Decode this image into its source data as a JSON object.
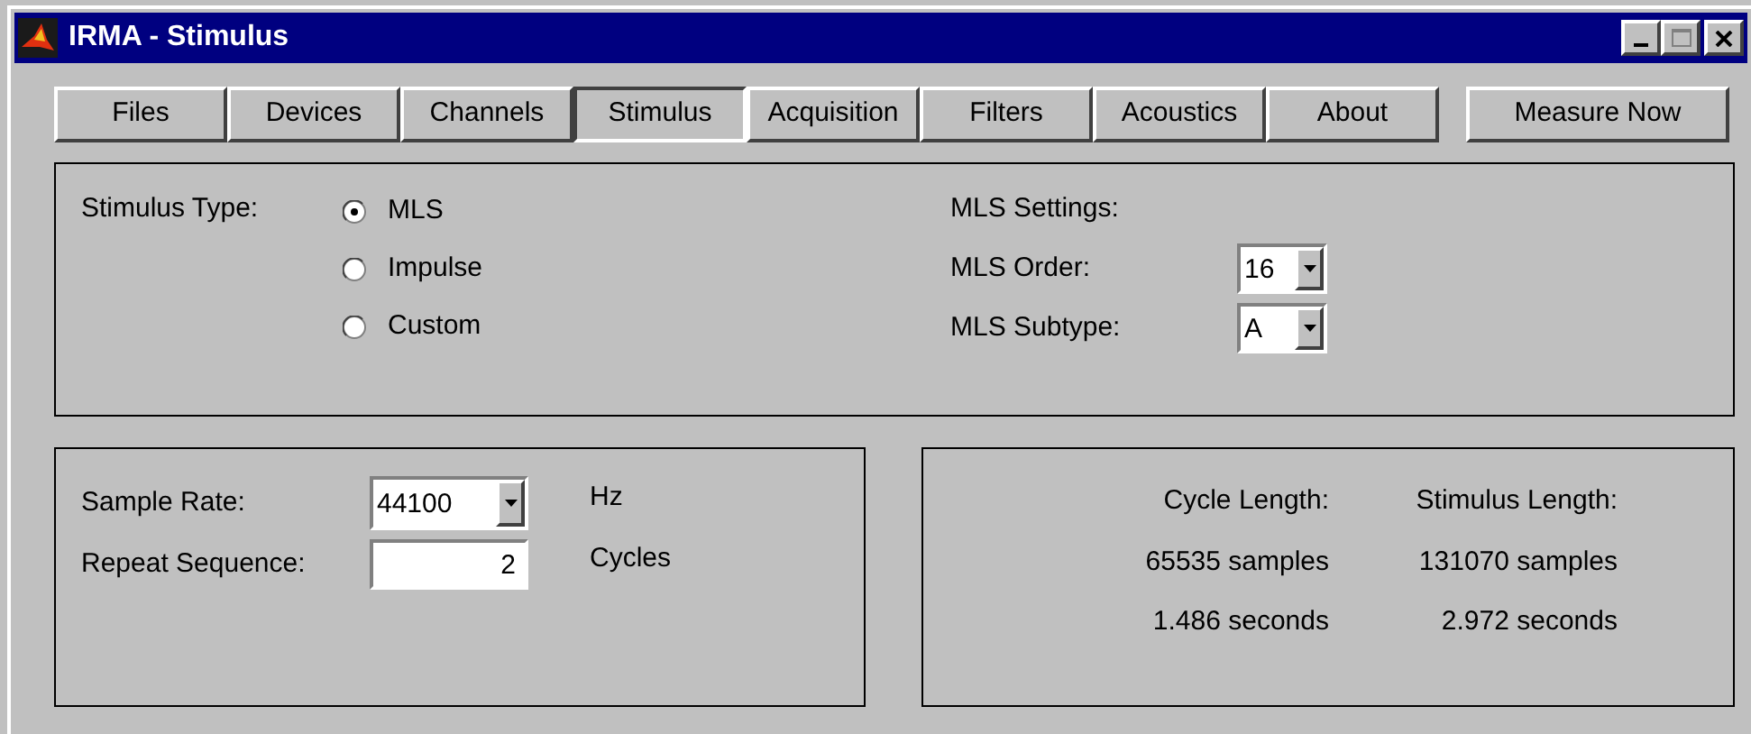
{
  "window": {
    "title": "IRMA - Stimulus"
  },
  "tabs": [
    {
      "label": "Files",
      "selected": false
    },
    {
      "label": "Devices",
      "selected": false
    },
    {
      "label": "Channels",
      "selected": false
    },
    {
      "label": "Stimulus",
      "selected": true
    },
    {
      "label": "Acquisition",
      "selected": false
    },
    {
      "label": "Filters",
      "selected": false
    },
    {
      "label": "Acoustics",
      "selected": false
    },
    {
      "label": "About",
      "selected": false
    }
  ],
  "measure_button": "Measure Now",
  "stimulus_type": {
    "label": "Stimulus Type:",
    "options": [
      {
        "label": "MLS",
        "selected": true
      },
      {
        "label": "Impulse",
        "selected": false
      },
      {
        "label": "Custom",
        "selected": false
      }
    ]
  },
  "mls_settings": {
    "heading": "MLS Settings:",
    "order": {
      "label": "MLS Order:",
      "value": "16"
    },
    "subtype": {
      "label": "MLS Subtype:",
      "value": "A"
    }
  },
  "sample_rate": {
    "label": "Sample Rate:",
    "value": "44100",
    "unit": "Hz"
  },
  "repeat_sequence": {
    "label": "Repeat Sequence:",
    "value": "2",
    "unit": "Cycles"
  },
  "summary": {
    "columns": [
      "Cycle Length:",
      "Stimulus Length:"
    ],
    "rows": [
      [
        "65535 samples",
        "131070 samples"
      ],
      [
        "1.486 seconds",
        "2.972 seconds"
      ]
    ]
  }
}
